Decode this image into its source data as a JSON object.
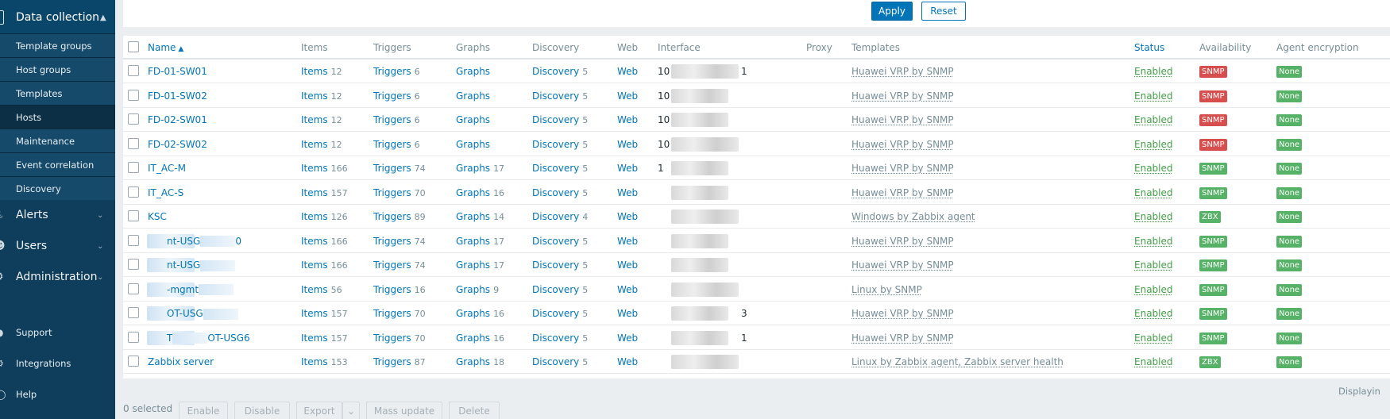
{
  "sidebar": {
    "section_title": "Data collection",
    "sub_items": [
      {
        "label": "Template groups"
      },
      {
        "label": "Host groups"
      },
      {
        "label": "Templates"
      },
      {
        "label": "Hosts"
      },
      {
        "label": "Maintenance"
      },
      {
        "label": "Event correlation"
      },
      {
        "label": "Discovery"
      }
    ],
    "main_items": [
      {
        "label": "Alerts"
      },
      {
        "label": "Users"
      },
      {
        "label": "Administration"
      }
    ],
    "footer_items": [
      {
        "label": "Support"
      },
      {
        "label": "Integrations"
      },
      {
        "label": "Help"
      }
    ]
  },
  "filter": {
    "apply_label": "Apply",
    "reset_label": "Reset"
  },
  "table": {
    "columns": {
      "name": "Name",
      "items": "Items",
      "triggers": "Triggers",
      "graphs": "Graphs",
      "discovery": "Discovery",
      "web": "Web",
      "interface": "Interface",
      "proxy": "Proxy",
      "templates": "Templates",
      "status": "Status",
      "availability": "Availability",
      "agent_encryption": "Agent encryption"
    },
    "rows": [
      {
        "name": "FD-01-SW01",
        "items_label": "Items",
        "items_count": "12",
        "triggers_label": "Triggers",
        "triggers_count": "6",
        "graphs_label": "Graphs",
        "graphs_count": "",
        "discovery_label": "Discovery",
        "discovery_count": "5",
        "web": "Web",
        "interface": "10",
        "interface_tail": "1",
        "templates": "Huawei VRP by SNMP",
        "status": "Enabled",
        "availability": "SNMP",
        "availability_color": "red",
        "encryption": "None"
      },
      {
        "name": "FD-01-SW02",
        "items_label": "Items",
        "items_count": "12",
        "triggers_label": "Triggers",
        "triggers_count": "6",
        "graphs_label": "Graphs",
        "graphs_count": "",
        "discovery_label": "Discovery",
        "discovery_count": "5",
        "web": "Web",
        "interface": "10",
        "interface_tail": "",
        "templates": "Huawei VRP by SNMP",
        "status": "Enabled",
        "availability": "SNMP",
        "availability_color": "red",
        "encryption": "None"
      },
      {
        "name": "FD-02-SW01",
        "items_label": "Items",
        "items_count": "12",
        "triggers_label": "Triggers",
        "triggers_count": "6",
        "graphs_label": "Graphs",
        "graphs_count": "",
        "discovery_label": "Discovery",
        "discovery_count": "5",
        "web": "Web",
        "interface": "10",
        "interface_tail": "",
        "templates": "Huawei VRP by SNMP",
        "status": "Enabled",
        "availability": "SNMP",
        "availability_color": "red",
        "encryption": "None"
      },
      {
        "name": "FD-02-SW02",
        "items_label": "Items",
        "items_count": "12",
        "triggers_label": "Triggers",
        "triggers_count": "6",
        "graphs_label": "Graphs",
        "graphs_count": "",
        "discovery_label": "Discovery",
        "discovery_count": "5",
        "web": "Web",
        "interface": "10",
        "interface_tail": "",
        "templates": "Huawei VRP by SNMP",
        "status": "Enabled",
        "availability": "SNMP",
        "availability_color": "red",
        "encryption": "None"
      },
      {
        "name": "IT_AC-M",
        "items_label": "Items",
        "items_count": "166",
        "triggers_label": "Triggers",
        "triggers_count": "74",
        "graphs_label": "Graphs",
        "graphs_count": "17",
        "discovery_label": "Discovery",
        "discovery_count": "5",
        "web": "Web",
        "interface": "1",
        "interface_tail": "",
        "templates": "Huawei VRP by SNMP",
        "status": "Enabled",
        "availability": "SNMP",
        "availability_color": "green",
        "encryption": "None"
      },
      {
        "name": "IT_AC-S",
        "items_label": "Items",
        "items_count": "157",
        "triggers_label": "Triggers",
        "triggers_count": "70",
        "graphs_label": "Graphs",
        "graphs_count": "16",
        "discovery_label": "Discovery",
        "discovery_count": "5",
        "web": "Web",
        "interface": "",
        "interface_tail": "",
        "templates": "Huawei VRP by SNMP",
        "status": "Enabled",
        "availability": "SNMP",
        "availability_color": "green",
        "encryption": "None"
      },
      {
        "name": "KSC",
        "items_label": "Items",
        "items_count": "126",
        "triggers_label": "Triggers",
        "triggers_count": "89",
        "graphs_label": "Graphs",
        "graphs_count": "14",
        "discovery_label": "Discovery",
        "discovery_count": "4",
        "web": "Web",
        "interface": "",
        "interface_tail": "",
        "templates": "Windows by Zabbix agent",
        "status": "Enabled",
        "availability": "ZBX",
        "availability_color": "green",
        "encryption": "None"
      },
      {
        "name": "nt-USG",
        "name_tail": "0",
        "items_label": "Items",
        "items_count": "166",
        "triggers_label": "Triggers",
        "triggers_count": "74",
        "graphs_label": "Graphs",
        "graphs_count": "17",
        "discovery_label": "Discovery",
        "discovery_count": "5",
        "web": "Web",
        "interface": "",
        "interface_tail": "",
        "templates": "Huawei VRP by SNMP",
        "status": "Enabled",
        "availability": "SNMP",
        "availability_color": "green",
        "encryption": "None"
      },
      {
        "name": "nt-USG",
        "name_tail": "",
        "items_label": "Items",
        "items_count": "166",
        "triggers_label": "Triggers",
        "triggers_count": "74",
        "graphs_label": "Graphs",
        "graphs_count": "17",
        "discovery_label": "Discovery",
        "discovery_count": "5",
        "web": "Web",
        "interface": "",
        "interface_tail": "",
        "templates": "Huawei VRP by SNMP",
        "status": "Enabled",
        "availability": "SNMP",
        "availability_color": "green",
        "encryption": "None"
      },
      {
        "name": "-mgmt",
        "name_tail": "",
        "items_label": "Items",
        "items_count": "56",
        "triggers_label": "Triggers",
        "triggers_count": "16",
        "graphs_label": "Graphs",
        "graphs_count": "9",
        "discovery_label": "Discovery",
        "discovery_count": "5",
        "web": "Web",
        "interface": "",
        "interface_tail": "",
        "templates": "Linux by SNMP",
        "status": "Enabled",
        "availability": "SNMP",
        "availability_color": "green",
        "encryption": "None"
      },
      {
        "name": "OT-USG",
        "name_tail": "",
        "items_label": "Items",
        "items_count": "157",
        "triggers_label": "Triggers",
        "triggers_count": "70",
        "graphs_label": "Graphs",
        "graphs_count": "16",
        "discovery_label": "Discovery",
        "discovery_count": "5",
        "web": "Web",
        "interface": "",
        "interface_tail": "3",
        "templates": "Huawei VRP by SNMP",
        "status": "Enabled",
        "availability": "SNMP",
        "availability_color": "green",
        "encryption": "None"
      },
      {
        "name": "T",
        "name_tail": "OT-USG6",
        "items_label": "Items",
        "items_count": "157",
        "triggers_label": "Triggers",
        "triggers_count": "70",
        "graphs_label": "Graphs",
        "graphs_count": "16",
        "discovery_label": "Discovery",
        "discovery_count": "5",
        "web": "Web",
        "interface": "",
        "interface_tail": "1",
        "templates": "Huawei VRP by SNMP",
        "status": "Enabled",
        "availability": "SNMP",
        "availability_color": "green",
        "encryption": "None"
      },
      {
        "name": "Zabbix server",
        "name_tail": "",
        "items_label": "Items",
        "items_count": "153",
        "triggers_label": "Triggers",
        "triggers_count": "87",
        "graphs_label": "Graphs",
        "graphs_count": "18",
        "discovery_label": "Discovery",
        "discovery_count": "5",
        "web": "Web",
        "interface": "",
        "interface_tail": "",
        "templates": "Linux by Zabbix agent, Zabbix server health",
        "status": "Enabled",
        "availability": "ZBX",
        "availability_color": "green",
        "encryption": "None"
      }
    ],
    "displaying": "Displayin"
  },
  "actions": {
    "selected": "0 selected",
    "buttons": [
      "Enable",
      "Disable",
      "Export",
      "Mass update",
      "Delete"
    ]
  }
}
